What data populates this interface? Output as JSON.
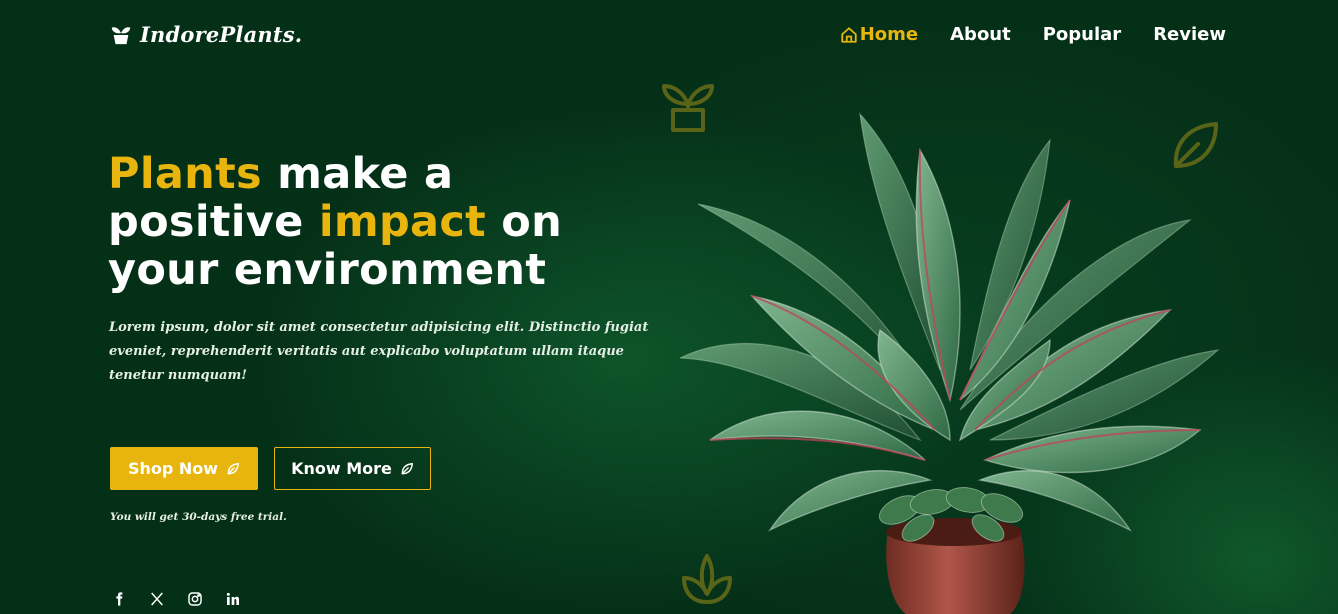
{
  "logo": {
    "text": "IndorePlants.",
    "icon": "plant-pot-icon"
  },
  "nav": {
    "items": [
      {
        "label": "Home",
        "active": true,
        "icon": "home-icon"
      },
      {
        "label": "About",
        "active": false
      },
      {
        "label": "Popular",
        "active": false
      },
      {
        "label": "Review",
        "active": false
      }
    ]
  },
  "hero": {
    "title": {
      "line1_accent": "Plants",
      "line1_rest": " make a",
      "line2_start": "positive ",
      "line2_accent": "impact",
      "line2_end": " on",
      "line3": "your environment"
    },
    "description": "Lorem ipsum, dolor sit amet consectetur adipisicing elit. Distinctio fugiat eveniet, reprehenderit veritatis aut explicabo voluptatum ullam itaque tenetur numquam!",
    "shop_button": "Shop Now",
    "know_button": "Know More",
    "button_icon": "leaf-icon",
    "trial_text": "You will get 30-days free trial."
  },
  "social": [
    "facebook-icon",
    "x-icon",
    "instagram-icon",
    "linkedin-icon"
  ],
  "colors": {
    "background": "#053018",
    "accent": "#e8b40e",
    "text": "#ffffff",
    "decor": "#5a6418"
  }
}
